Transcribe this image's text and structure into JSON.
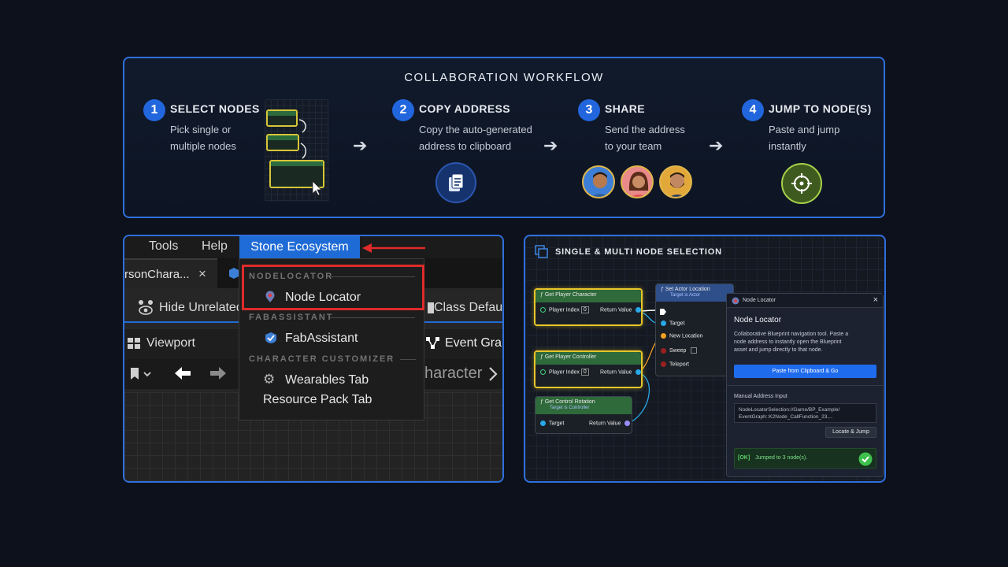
{
  "workflow": {
    "title": "COLLABORATION WORKFLOW",
    "steps": [
      {
        "num": "1",
        "title": "SELECT NODES",
        "desc1": "Pick single or",
        "desc2": "multiple nodes"
      },
      {
        "num": "2",
        "title": "COPY ADDRESS",
        "desc1": "Copy the auto-generated",
        "desc2": "address to clipboard"
      },
      {
        "num": "3",
        "title": "SHARE",
        "desc1": "Send the address",
        "desc2": "to your team"
      },
      {
        "num": "4",
        "title": "JUMP TO NODE(S)",
        "desc1": "Paste and jump",
        "desc2": "instantly"
      }
    ],
    "arrow": "➔"
  },
  "menu": {
    "menubar": {
      "tools": "Tools",
      "help": "Help",
      "active": "Stone Ecosystem"
    },
    "tab": {
      "label": "rsonChara...",
      "close": "×"
    },
    "toolbar": {
      "hide": "Hide Unrelated",
      "class_defaults": "Class Defau"
    },
    "row3": {
      "viewport": "Viewport",
      "event_graph": "Event Grap"
    },
    "row4": {
      "character": "haracter"
    },
    "dropdown": {
      "section1": "NODELOCATOR",
      "node_locator": "Node Locator",
      "section2": "FABASSISTANT",
      "fab_assistant": "FabAssistant",
      "section3": "CHARACTER CUSTOMIZER",
      "wearables": "Wearables Tab",
      "resource_pack": "Resource Pack Tab"
    }
  },
  "nodes": {
    "title": "SINGLE & MULTI NODE SELECTION",
    "get_player_character": {
      "title": "Get Player Character",
      "player_index": "Player Index",
      "index_value": "0",
      "return_value": "Return Value"
    },
    "get_player_controller": {
      "title": "Get Player Controller",
      "player_index": "Player Index",
      "index_value": "0",
      "return_value": "Return Value"
    },
    "get_control_rotation": {
      "title": "Get Control Rotation",
      "subtitle": "Target is Controller",
      "target": "Target",
      "return_value": "Return Value"
    },
    "set_actor_location": {
      "title": "Set Actor Location",
      "subtitle": "Target is Actor",
      "target": "Target",
      "new_location": "New Location",
      "sweep": "Sweep",
      "teleport": "Teleport"
    },
    "locator": {
      "window_title": "Node Locator",
      "close": "×",
      "heading": "Node Locator",
      "desc1": "Collaborative Blueprint navigation tool. Paste a",
      "desc2": "node address to instantly open the Blueprint",
      "desc3": "asset and jump directly to that node.",
      "paste_button": "Paste from Clipboard & Go",
      "manual_label": "Manual Address Input",
      "address1": "NodeLocatorSelection://Game/BP_Example/",
      "address2": "EventGraph::K2Node_CallFunction_23,...",
      "locate_button": "Locate & Jump",
      "status_tag": "[OK]",
      "status_text": "Jumped to 3 node(s)."
    }
  },
  "colors": {
    "accent": "#2f6fdc",
    "menu_active": "#1f6bd6",
    "highlight": "#e02a2a",
    "selected_node": "#e7c52a",
    "ok": "#3ec04d"
  }
}
